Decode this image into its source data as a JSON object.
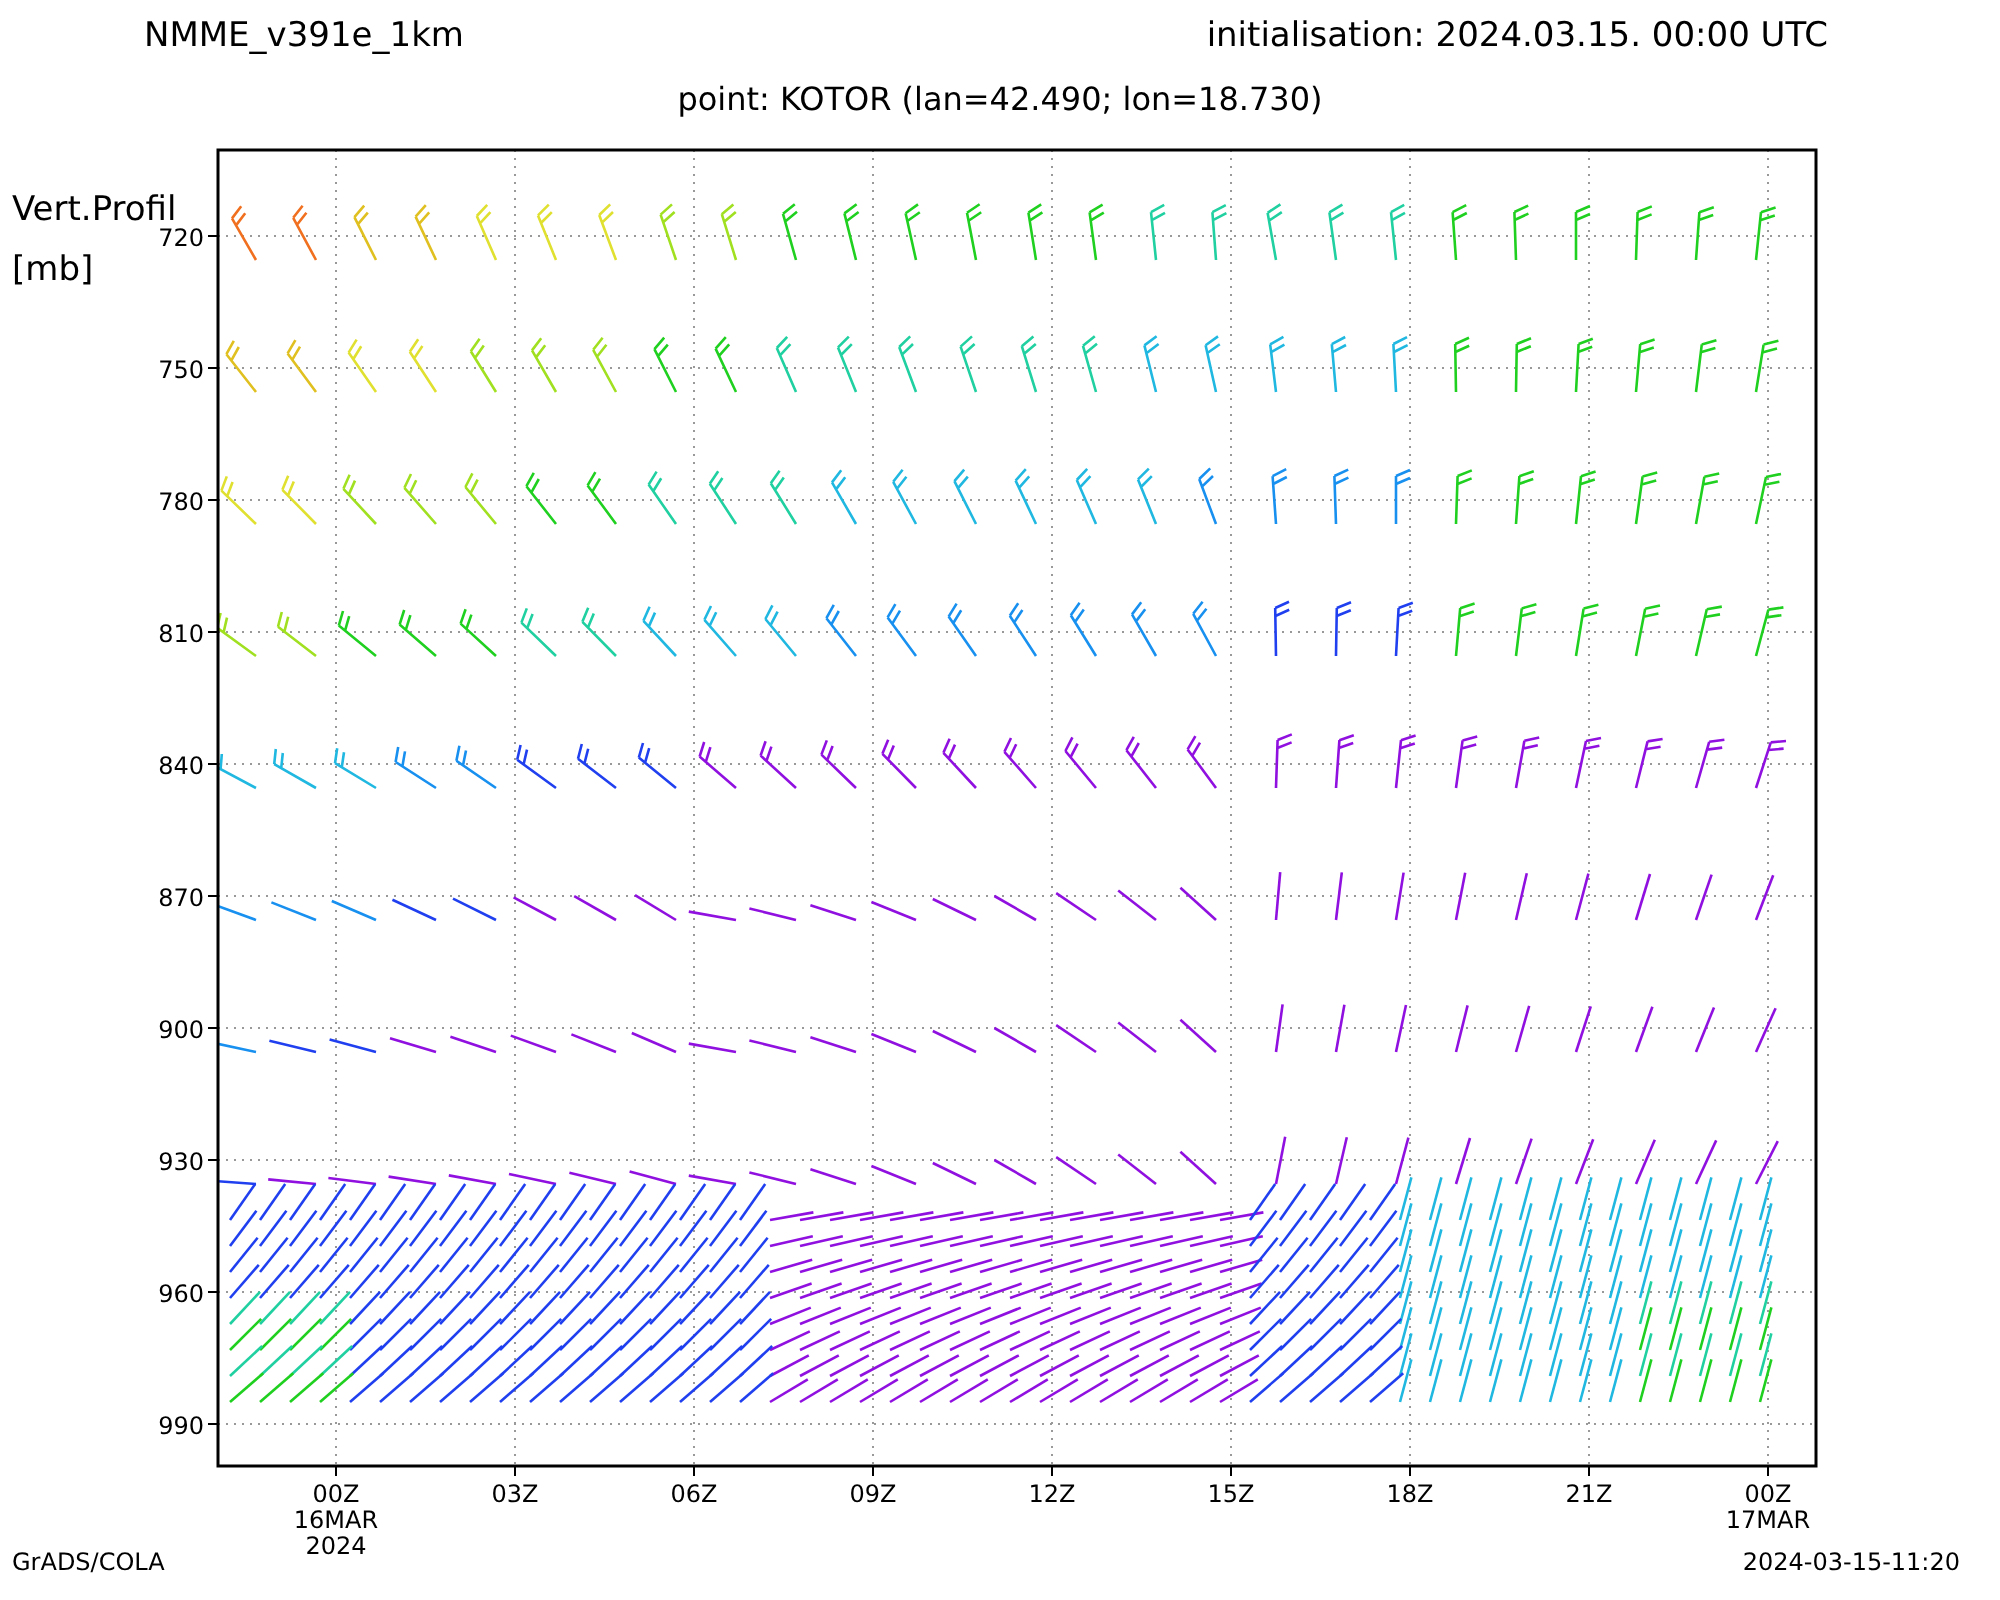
{
  "header": {
    "model": "NMME_v391e_1km",
    "initialisation": "initialisation:  2024.03.15.  00:00  UTC"
  },
  "subtitle": "point: KOTOR (lan=42.490; lon=18.730)",
  "plot": {
    "y_label": [
      "Vert.Profil",
      "[mb]"
    ],
    "y_ticks": [
      "720",
      "750",
      "780",
      "810",
      "840",
      "870",
      "900",
      "930",
      "960",
      "990"
    ],
    "x_ticks": [
      {
        "label": "00Z",
        "date": "16MAR",
        "year": "2024"
      },
      {
        "label": "03Z"
      },
      {
        "label": "06Z"
      },
      {
        "label": "09Z"
      },
      {
        "label": "12Z"
      },
      {
        "label": "15Z"
      },
      {
        "label": "18Z"
      },
      {
        "label": "21Z"
      },
      {
        "label": "00Z",
        "date": "17MAR"
      }
    ]
  },
  "footer": {
    "left": "GrADS/COLA",
    "right": "2024-03-15-11:20"
  }
}
